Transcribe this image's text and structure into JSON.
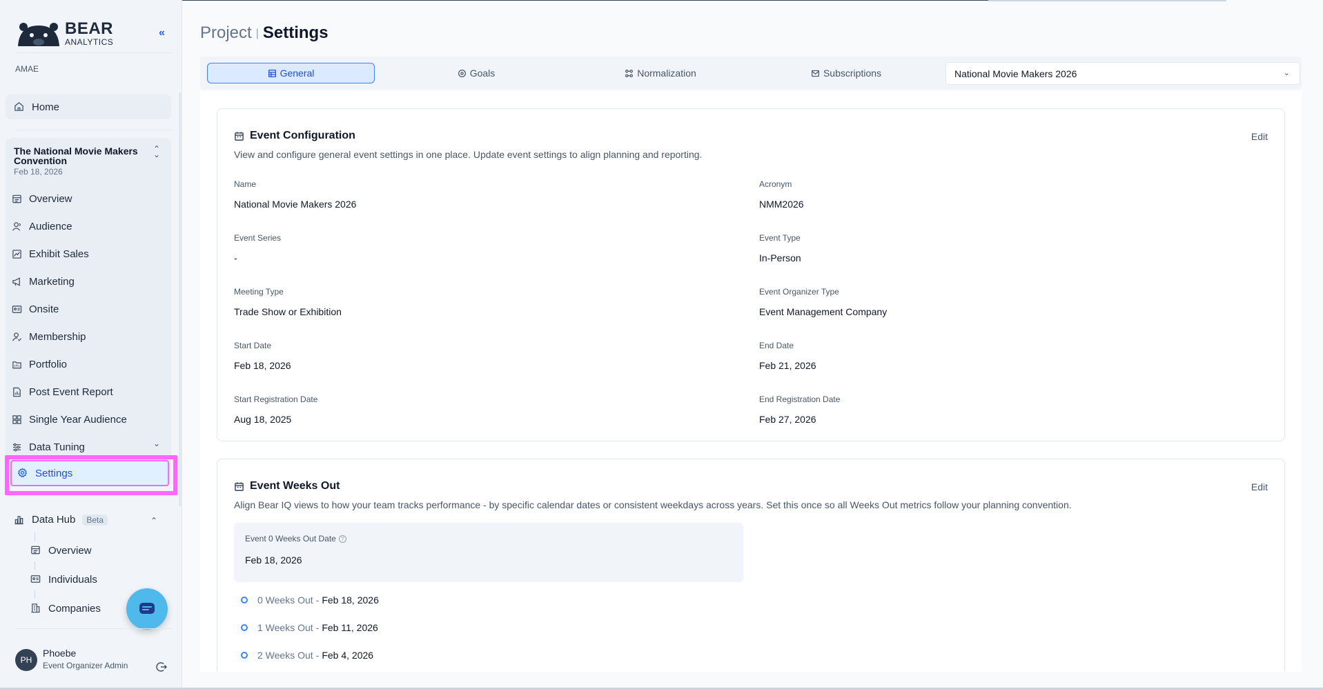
{
  "brand": {
    "name": "BEAR",
    "subname": "ANALYTICS"
  },
  "org": "AMAE",
  "sidebar": {
    "home": "Home",
    "event": {
      "title": "The National Movie Makers Convention",
      "date": "Feb 18, 2026"
    },
    "items": [
      {
        "label": "Overview",
        "icon": "overview-icon"
      },
      {
        "label": "Audience",
        "icon": "audience-icon"
      },
      {
        "label": "Exhibit Sales",
        "icon": "chart-icon"
      },
      {
        "label": "Marketing",
        "icon": "megaphone-icon"
      },
      {
        "label": "Onsite",
        "icon": "badge-icon"
      },
      {
        "label": "Membership",
        "icon": "member-icon"
      },
      {
        "label": "Portfolio",
        "icon": "portfolio-icon"
      },
      {
        "label": "Post Event Report",
        "icon": "report-icon"
      },
      {
        "label": "Single Year Audience",
        "icon": "grid-icon"
      },
      {
        "label": "Data Tuning",
        "icon": "sliders-icon"
      }
    ],
    "settings": "Settings",
    "datahub": {
      "label": "Data Hub",
      "badge": "Beta",
      "items": [
        "Overview",
        "Individuals",
        "Companies"
      ]
    },
    "user": {
      "initials": "PH",
      "name": "Phoebe",
      "role": "Event Organizer Admin"
    }
  },
  "header": {
    "crumb": "Project",
    "title": "Settings"
  },
  "tabs": [
    {
      "label": "General",
      "active": true
    },
    {
      "label": "Goals",
      "active": false
    },
    {
      "label": "Normalization",
      "active": false
    },
    {
      "label": "Subscriptions",
      "active": false
    }
  ],
  "event_select": "National Movie Makers 2026",
  "config": {
    "title": "Event Configuration",
    "desc": "View and configure general event settings in one place. Update event settings to align planning and reporting.",
    "edit": "Edit",
    "fields": [
      {
        "label": "Name",
        "value": "National Movie Makers 2026"
      },
      {
        "label": "Acronym",
        "value": "NMM2026"
      },
      {
        "label": "Event Series",
        "value": "-"
      },
      {
        "label": "Event Type",
        "value": "In-Person"
      },
      {
        "label": "Meeting Type",
        "value": "Trade Show or Exhibition"
      },
      {
        "label": "Event Organizer Type",
        "value": "Event Management Company"
      },
      {
        "label": "Start Date",
        "value": "Feb 18, 2026"
      },
      {
        "label": "End Date",
        "value": "Feb 21, 2026"
      },
      {
        "label": "Start Registration Date",
        "value": "Aug 18, 2025"
      },
      {
        "label": "End Registration Date",
        "value": "Feb 27, 2026"
      }
    ]
  },
  "weeks": {
    "title": "Event Weeks Out",
    "desc": "Align Bear IQ views to how your team tracks performance - by specific calendar dates or consistent weekdays across years. Set this once so all Weeks Out metrics follow your planning convention.",
    "edit": "Edit",
    "zero_label": "Event 0 Weeks Out Date",
    "zero_value": "Feb 18, 2026",
    "timeline": [
      {
        "weeks": "0 Weeks Out",
        "date": "Feb 18, 2026"
      },
      {
        "weeks": "1 Weeks Out",
        "date": "Feb 11, 2026"
      },
      {
        "weeks": "2 Weeks Out",
        "date": "Feb 4, 2026"
      }
    ]
  }
}
